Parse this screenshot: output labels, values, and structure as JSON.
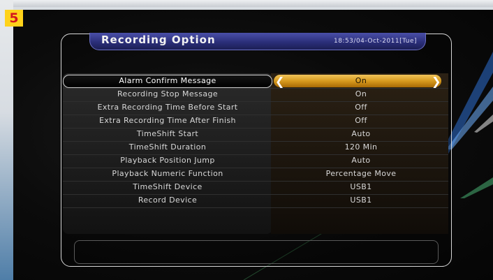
{
  "badge": "5",
  "header": {
    "title": "Recording Option",
    "datetime": "18:53/04-Oct-2011[Tue]"
  },
  "options": [
    {
      "label": "Alarm Confirm Message",
      "value": "On",
      "selected": true
    },
    {
      "label": "Recording Stop Message",
      "value": "On"
    },
    {
      "label": "Extra Recording Time Before Start",
      "value": "Off"
    },
    {
      "label": "Extra Recording Time After Finish",
      "value": "Off"
    },
    {
      "label": "TimeShift Start",
      "value": "Auto"
    },
    {
      "label": "TimeShift Duration",
      "value": "120 Min"
    },
    {
      "label": "Playback Position Jump",
      "value": "Auto"
    },
    {
      "label": "Playback Numeric Function",
      "value": "Percentage Move"
    },
    {
      "label": "TimeShift Device",
      "value": "USB1"
    },
    {
      "label": "Record Device",
      "value": "USB1"
    }
  ],
  "icons": {
    "left": "chevron-left-icon",
    "right": "chevron-right-icon"
  },
  "colors": {
    "highlight": "#d79a1e",
    "title_bar": "#2b2f7a",
    "badge": "#ffd21a"
  }
}
